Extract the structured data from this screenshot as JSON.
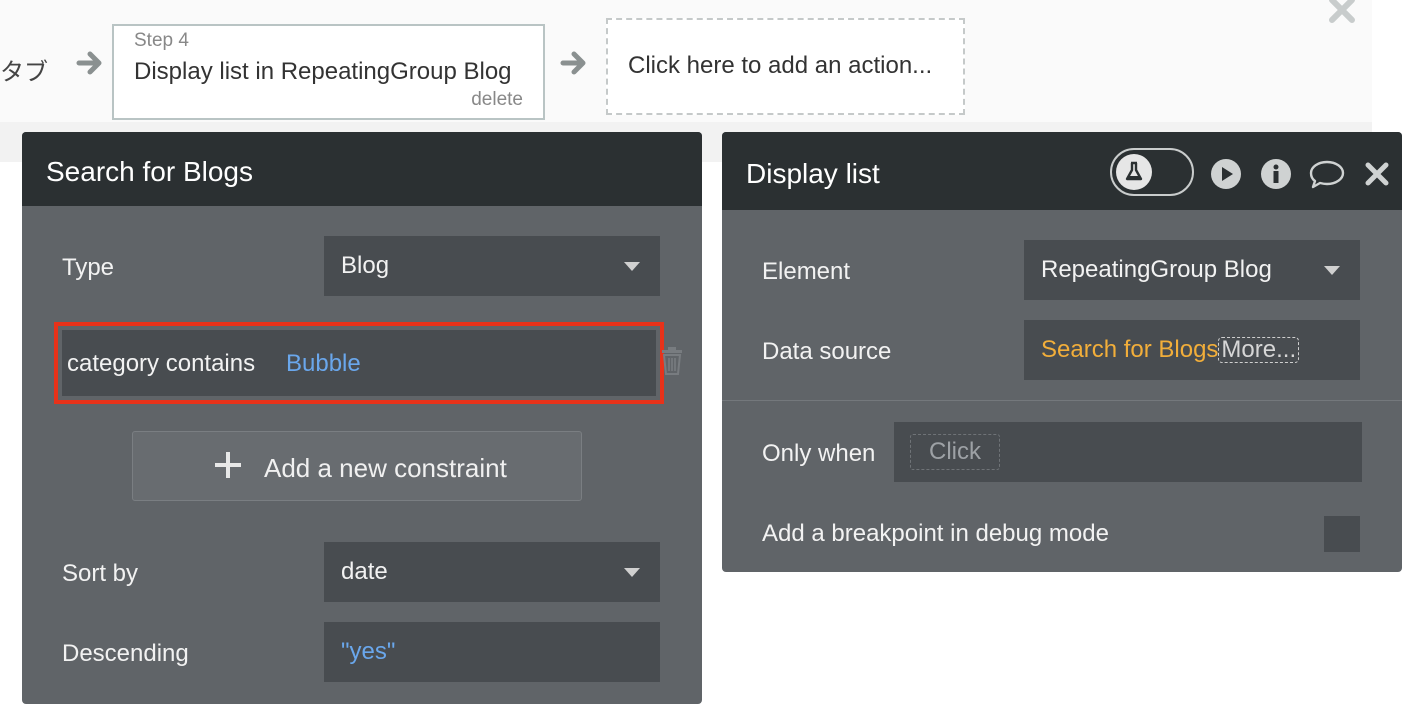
{
  "workflow": {
    "prev_step_fragment": "タブ",
    "step4": {
      "number_label": "Step 4",
      "title": "Display list in RepeatingGroup Blog",
      "delete_label": "delete"
    },
    "add_action_label": "Click here to add an action..."
  },
  "search_panel": {
    "title": "Search for Blogs",
    "type_label": "Type",
    "type_value": "Blog",
    "constraint": {
      "field": "category contains",
      "value": "Bubble"
    },
    "add_constraint_label": "Add a new constraint",
    "sort_by_label": "Sort by",
    "sort_by_value": "date",
    "descending_label": "Descending",
    "descending_value": "\"yes\""
  },
  "display_panel": {
    "title": "Display list",
    "element_label": "Element",
    "element_value": "RepeatingGroup Blog",
    "data_source_label": "Data source",
    "data_source_value": "Search for Blogs",
    "data_source_more": "More...",
    "only_when_label": "Only when",
    "only_when_placeholder": "Click",
    "breakpoint_label": "Add a breakpoint in debug mode",
    "breakpoint_checked": false
  },
  "icons": {
    "arrow": "arrow-right-icon",
    "close": "close-icon",
    "trash": "trash-icon",
    "plus": "plus-icon",
    "flask": "flask-icon",
    "play": "play-icon",
    "info": "info-icon",
    "comment": "comment-icon"
  },
  "colors": {
    "panel_header": "#2b3032",
    "panel_body": "#606468",
    "field_bg": "#484c50",
    "dynamic_blue": "#6aa7ec",
    "dynamic_orange": "#f2ae3a",
    "highlight_red": "#e8321a"
  }
}
